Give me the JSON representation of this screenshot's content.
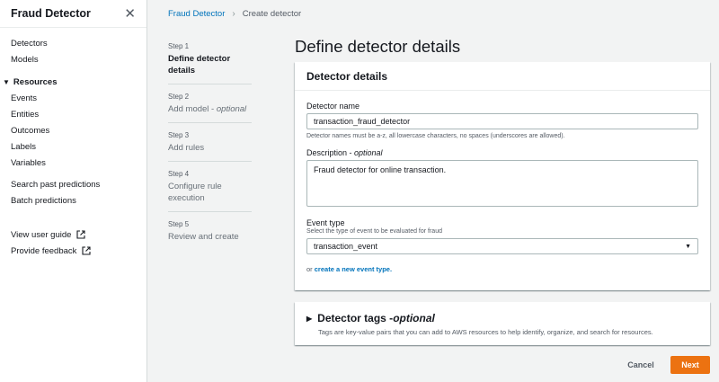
{
  "sidebar": {
    "title": "Fraud Detector",
    "close_icon": "close-icon",
    "items_top": [
      "Detectors",
      "Models"
    ],
    "resources_label": "Resources",
    "resources": [
      "Events",
      "Entities",
      "Outcomes",
      "Labels",
      "Variables"
    ],
    "items_mid": [
      "Search past predictions",
      "Batch predictions"
    ],
    "items_bottom": [
      "View user guide",
      "Provide feedback"
    ]
  },
  "breadcrumb": {
    "root": "Fraud Detector",
    "current": "Create detector"
  },
  "steps": [
    {
      "num": "Step 1",
      "title": "Define detector details",
      "suffix": ""
    },
    {
      "num": "Step 2",
      "title": "Add model - ",
      "suffix": "optional"
    },
    {
      "num": "Step 3",
      "title": "Add rules",
      "suffix": ""
    },
    {
      "num": "Step 4",
      "title": "Configure rule execution",
      "suffix": ""
    },
    {
      "num": "Step 5",
      "title": "Review and create",
      "suffix": ""
    }
  ],
  "main": {
    "title": "Define detector details"
  },
  "details_panel": {
    "header": "Detector details",
    "name_label": "Detector name",
    "name_value": "transaction_fraud_detector",
    "name_hint": "Detector names must be a-z, all lowercase characters, no spaces (underscores are allowed).",
    "desc_label": "Description - ",
    "desc_label_suffix": "optional",
    "desc_value": "Fraud detector for online transaction.",
    "event_label": "Event type",
    "event_hint": "Select the type of event to be evaluated for fraud",
    "event_value": "transaction_event",
    "link_prefix": "or ",
    "link_text": "create a new event type."
  },
  "tags_panel": {
    "title": "Detector tags - ",
    "title_suffix": "optional",
    "desc": "Tags are key-value pairs that you can add to AWS resources to help identify, organize, and search for resources."
  },
  "footer": {
    "cancel": "Cancel",
    "next": "Next"
  },
  "colors": {
    "accent": "#ec7211",
    "link": "#0073bb"
  }
}
